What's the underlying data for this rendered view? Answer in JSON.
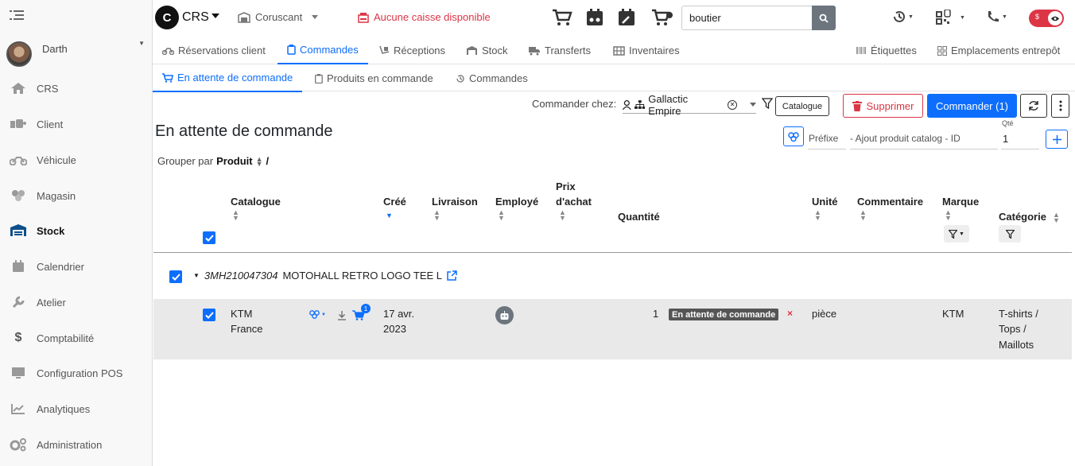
{
  "sidebar": {
    "user": {
      "name": "Darth"
    },
    "items": [
      {
        "label": "CRS",
        "icon": "home-icon"
      },
      {
        "label": "Client",
        "icon": "client-icon"
      },
      {
        "label": "Véhicule",
        "icon": "motorcycle-icon"
      },
      {
        "label": "Magasin",
        "icon": "store-icon"
      },
      {
        "label": "Stock",
        "icon": "warehouse-icon",
        "active": true
      },
      {
        "label": "Calendrier",
        "icon": "calendar-icon"
      },
      {
        "label": "Atelier",
        "icon": "wrench-icon"
      },
      {
        "label": "Comptabilité",
        "icon": "dollar-icon"
      },
      {
        "label": "Configuration POS",
        "icon": "monitor-icon"
      },
      {
        "label": "Analytiques",
        "icon": "chart-icon"
      },
      {
        "label": "Administration",
        "icon": "gears-icon"
      }
    ]
  },
  "topbar": {
    "logo_letter": "C",
    "logo_text": "CRS",
    "store": "Coruscant",
    "cash_status": "Aucune caisse disponible",
    "search_value": "boutier",
    "toggle_symbol": "$"
  },
  "tabs_main": [
    {
      "label": "Réservations client"
    },
    {
      "label": "Commandes",
      "active": true
    },
    {
      "label": "Réceptions"
    },
    {
      "label": "Stock"
    },
    {
      "label": "Transferts"
    },
    {
      "label": "Inventaires"
    },
    {
      "label": "Étiquettes"
    },
    {
      "label": "Emplacements entrepôt"
    }
  ],
  "tabs_sub": [
    {
      "label": "En attente de commande",
      "active": true
    },
    {
      "label": "Produits en commande"
    },
    {
      "label": "Commandes"
    }
  ],
  "toolbar": {
    "order_at_label": "Commander chez:",
    "supplier": "Gallactic Empire",
    "catalogue_btn": "Catalogue",
    "delete_btn": "Supprimer",
    "order_btn": "Commander (1)"
  },
  "page": {
    "title": "En attente de commande",
    "group_by_label": "Grouper par",
    "group_by_value": "Produit",
    "group_by_sep": "/",
    "prefix_label": "Préfixe",
    "add_product_placeholder": "- Ajout produit catalog - ID",
    "qty_label": "Qté",
    "qty_value": "1"
  },
  "table": {
    "headers": {
      "catalogue": "Catalogue",
      "created": "Créé",
      "delivery": "Livraison",
      "employee": "Employé",
      "purchase_price_1": "Prix",
      "purchase_price_2": "d'achat",
      "quantity": "Quantité",
      "unit": "Unité",
      "comment": "Commentaire",
      "brand": "Marque",
      "category": "Catégorie"
    },
    "group": {
      "sku": "3MH210047304",
      "name": "MOTOHALL RETRO LOGO TEE L"
    },
    "rows": [
      {
        "catalogue_1": "KTM",
        "catalogue_2": "France",
        "notif_count": "1",
        "created_1": "17 avr.",
        "created_2": "2023",
        "quantity": "1",
        "status": "En attente de commande",
        "status_remove": "×",
        "unit": "pièce",
        "brand": "KTM",
        "category_1": "T-shirts /",
        "category_2": "Tops /",
        "category_3": "Maillots"
      }
    ]
  }
}
